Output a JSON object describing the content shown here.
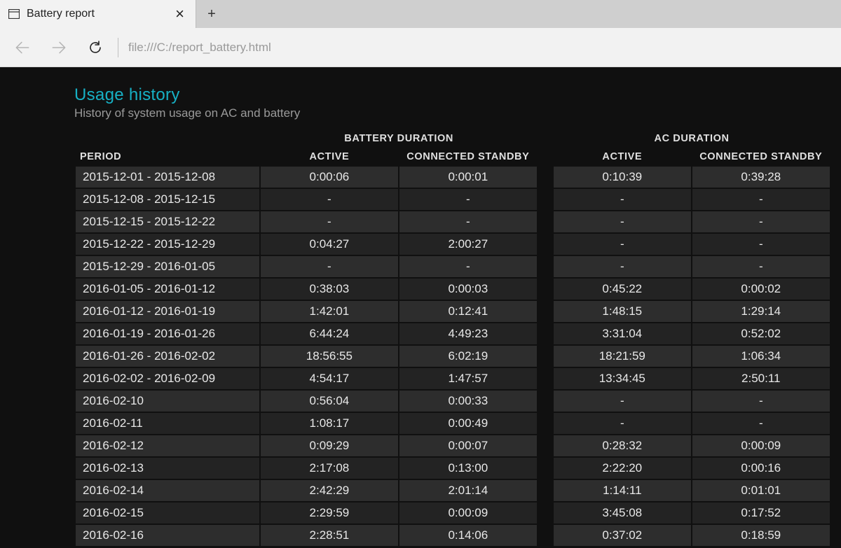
{
  "browser": {
    "tab_title": "Battery report",
    "url": "file:///C:/report_battery.html"
  },
  "report": {
    "title": "Usage history",
    "subtitle": "History of system usage on AC and battery",
    "group_headers": {
      "battery": "BATTERY DURATION",
      "ac": "AC DURATION"
    },
    "columns": {
      "period": "PERIOD",
      "active": "ACTIVE",
      "standby": "CONNECTED STANDBY"
    },
    "rows": [
      {
        "period": "2015-12-01 - 2015-12-08",
        "b_active": "0:00:06",
        "b_standby": "0:00:01",
        "a_active": "0:10:39",
        "a_standby": "0:39:28"
      },
      {
        "period": "2015-12-08 - 2015-12-15",
        "b_active": "-",
        "b_standby": "-",
        "a_active": "-",
        "a_standby": "-"
      },
      {
        "period": "2015-12-15 - 2015-12-22",
        "b_active": "-",
        "b_standby": "-",
        "a_active": "-",
        "a_standby": "-"
      },
      {
        "period": "2015-12-22 - 2015-12-29",
        "b_active": "0:04:27",
        "b_standby": "2:00:27",
        "a_active": "-",
        "a_standby": "-"
      },
      {
        "period": "2015-12-29 - 2016-01-05",
        "b_active": "-",
        "b_standby": "-",
        "a_active": "-",
        "a_standby": "-"
      },
      {
        "period": "2016-01-05 - 2016-01-12",
        "b_active": "0:38:03",
        "b_standby": "0:00:03",
        "a_active": "0:45:22",
        "a_standby": "0:00:02"
      },
      {
        "period": "2016-01-12 - 2016-01-19",
        "b_active": "1:42:01",
        "b_standby": "0:12:41",
        "a_active": "1:48:15",
        "a_standby": "1:29:14"
      },
      {
        "period": "2016-01-19 - 2016-01-26",
        "b_active": "6:44:24",
        "b_standby": "4:49:23",
        "a_active": "3:31:04",
        "a_standby": "0:52:02"
      },
      {
        "period": "2016-01-26 - 2016-02-02",
        "b_active": "18:56:55",
        "b_standby": "6:02:19",
        "a_active": "18:21:59",
        "a_standby": "1:06:34"
      },
      {
        "period": "2016-02-02 - 2016-02-09",
        "b_active": "4:54:17",
        "b_standby": "1:47:57",
        "a_active": "13:34:45",
        "a_standby": "2:50:11"
      },
      {
        "period": "2016-02-10",
        "b_active": "0:56:04",
        "b_standby": "0:00:33",
        "a_active": "-",
        "a_standby": "-"
      },
      {
        "period": "2016-02-11",
        "b_active": "1:08:17",
        "b_standby": "0:00:49",
        "a_active": "-",
        "a_standby": "-"
      },
      {
        "period": "2016-02-12",
        "b_active": "0:09:29",
        "b_standby": "0:00:07",
        "a_active": "0:28:32",
        "a_standby": "0:00:09"
      },
      {
        "period": "2016-02-13",
        "b_active": "2:17:08",
        "b_standby": "0:13:00",
        "a_active": "2:22:20",
        "a_standby": "0:00:16"
      },
      {
        "period": "2016-02-14",
        "b_active": "2:42:29",
        "b_standby": "2:01:14",
        "a_active": "1:14:11",
        "a_standby": "0:01:01"
      },
      {
        "period": "2016-02-15",
        "b_active": "2:29:59",
        "b_standby": "0:00:09",
        "a_active": "3:45:08",
        "a_standby": "0:17:52"
      },
      {
        "period": "2016-02-16",
        "b_active": "2:28:51",
        "b_standby": "0:14:06",
        "a_active": "0:37:02",
        "a_standby": "0:18:59"
      }
    ]
  }
}
